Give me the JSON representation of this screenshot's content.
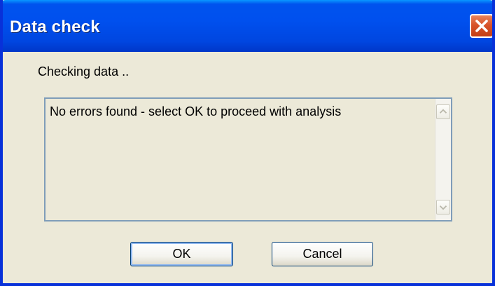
{
  "window": {
    "title": "Data check"
  },
  "status": {
    "label": "Checking data .."
  },
  "message": {
    "text": "No errors found - select OK to proceed with analysis"
  },
  "buttons": {
    "ok_label": "OK",
    "cancel_label": "Cancel"
  },
  "icons": {
    "close": "close-icon",
    "scroll_up": "chevron-up-icon",
    "scroll_down": "chevron-down-icon"
  },
  "colors": {
    "titlebar": "#0053ee",
    "window_bg": "#ece9d8",
    "close_button": "#d8532a",
    "field_border": "#7f9db9"
  }
}
